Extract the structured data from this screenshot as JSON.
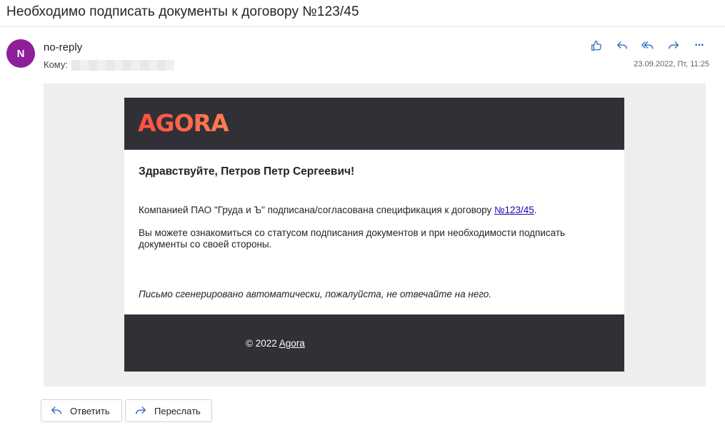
{
  "subject": "Необходимо подписать документы к договору №123/45",
  "sender": {
    "avatar_letter": "N",
    "name": "no-reply",
    "to_label": "Кому:",
    "date": "23.09.2022, Пт, 11:25"
  },
  "actions": {
    "icons": [
      "like-icon",
      "reply-icon",
      "reply-all-icon",
      "forward-icon",
      "more-icon"
    ],
    "more": "···"
  },
  "email": {
    "logo": "AGORA",
    "greeting": "Здравствуйте, Петров Петр Сергеевич!",
    "para1_text": "Компанией ПАО \"Груда и Ъ\" подписана/согласована спецификация к договору ",
    "para1_link": "№123/45",
    "para1_end": ".",
    "para2": "Вы можете ознакомиться со статусом подписания документов и при необходимости подписать документы со своей стороны.",
    "auto_note": "Письмо сгенерировано автоматически, пожалуйста, не отвечайте на него.",
    "footer_copy": "© 2022 ",
    "footer_link": "Agora"
  },
  "buttons": {
    "reply": "Ответить",
    "forward": "Переслать"
  },
  "colors": {
    "avatar": "#8d1f9a",
    "header_bg": "#313036",
    "logo": "#ff5a4a",
    "accent_icons": "#1f5fbf"
  }
}
